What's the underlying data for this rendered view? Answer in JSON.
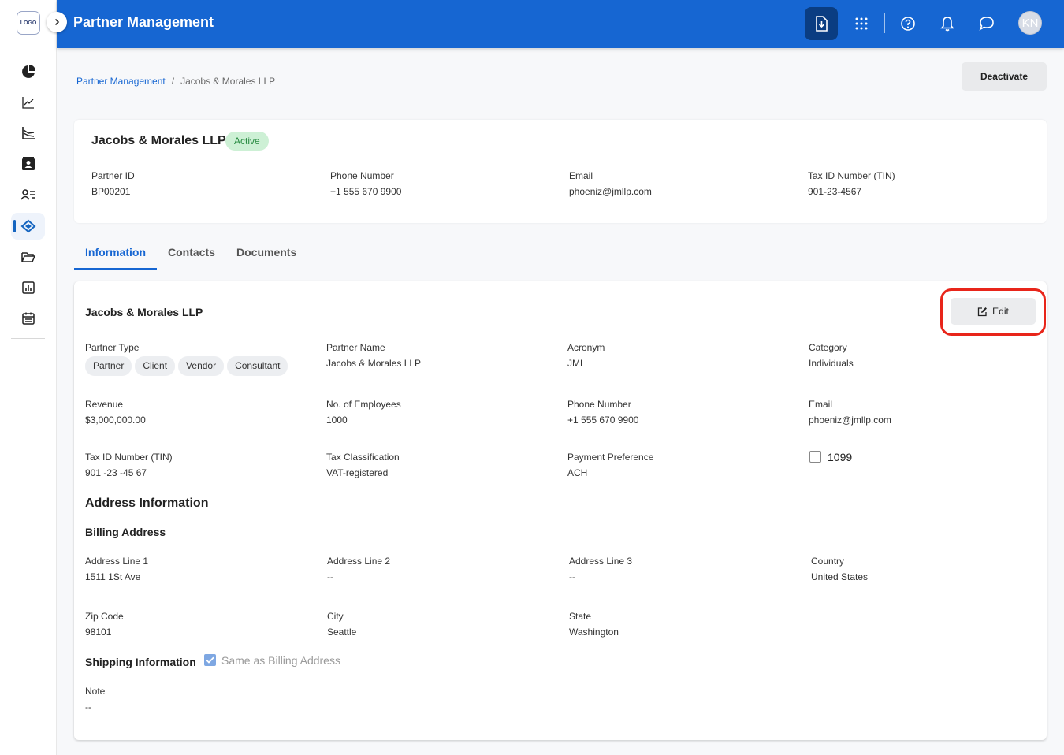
{
  "sidebar": {
    "logo": "LOGO",
    "items": [
      {
        "icon": "pie-chart-icon"
      },
      {
        "icon": "line-chart-icon"
      },
      {
        "icon": "trend-chart-icon"
      },
      {
        "icon": "contact-book-icon"
      },
      {
        "icon": "user-list-icon"
      },
      {
        "icon": "handshake-icon",
        "active": true
      },
      {
        "icon": "folder-open-icon"
      },
      {
        "icon": "report-icon"
      },
      {
        "icon": "calendar-icon"
      }
    ]
  },
  "header": {
    "title": "Partner Management",
    "avatar_initials": "KN",
    "icons": [
      "download-doc-icon",
      "apps-grid-icon",
      "help-icon",
      "bell-icon",
      "chat-icon"
    ]
  },
  "breadcrumb": {
    "parent": "Partner Management",
    "separator": "/",
    "current": "Jacobs & Morales LLP"
  },
  "actions": {
    "deactivate": "Deactivate",
    "edit": "Edit"
  },
  "summary": {
    "name": "Jacobs & Morales LLP",
    "status": "Active",
    "fields": [
      {
        "label": "Partner ID",
        "value": "BP00201"
      },
      {
        "label": "Phone Number",
        "value": "+1 555 670 9900"
      },
      {
        "label": "Email",
        "value": "phoeniz@jmllp.com"
      },
      {
        "label": "Tax ID Number (TIN)",
        "value": "901-23-4567"
      }
    ]
  },
  "tabs": [
    {
      "label": "Information",
      "active": true
    },
    {
      "label": "Contacts"
    },
    {
      "label": "Documents"
    }
  ],
  "info": {
    "title": "Jacobs & Morales LLP",
    "partner_type_label": "Partner Type",
    "partner_types": [
      "Partner",
      "Client",
      "Vendor",
      "Consultant"
    ],
    "fields": {
      "partner_name": {
        "label": "Partner Name",
        "value": "Jacobs & Morales LLP"
      },
      "acronym": {
        "label": "Acronym",
        "value": "JML"
      },
      "category": {
        "label": "Category",
        "value": "Individuals"
      },
      "revenue": {
        "label": "Revenue",
        "value": "$3,000,000.00"
      },
      "employees": {
        "label": "No. of Employees",
        "value": "1000"
      },
      "phone": {
        "label": "Phone Number",
        "value": "+1 555 670 9900"
      },
      "email": {
        "label": "Email",
        "value": "phoeniz@jmllp.com"
      },
      "tin": {
        "label": "Tax ID Number (TIN)",
        "value": "901 -23 -45 67"
      },
      "tax_class": {
        "label": "Tax Classification",
        "value": "VAT-registered"
      },
      "payment": {
        "label": "Payment Preference",
        "value": "ACH"
      }
    },
    "form_1099": {
      "label": "1099",
      "checked": false
    }
  },
  "address": {
    "section_title": "Address Information",
    "billing_title": "Billing Address",
    "line1": {
      "label": "Address Line 1",
      "value": "1511 1St Ave"
    },
    "line2": {
      "label": "Address Line 2",
      "value": "--"
    },
    "line3": {
      "label": "Address Line 3",
      "value": "--"
    },
    "country": {
      "label": "Country",
      "value": "United States"
    },
    "zip": {
      "label": "Zip Code",
      "value": "98101"
    },
    "city": {
      "label": "City",
      "value": "Seattle"
    },
    "state": {
      "label": "State",
      "value": "Washington"
    },
    "shipping_title": "Shipping Information",
    "same_as_billing": {
      "label": "Same as Billing Address",
      "checked": true
    },
    "note": {
      "label": "Note",
      "value": "--"
    }
  }
}
